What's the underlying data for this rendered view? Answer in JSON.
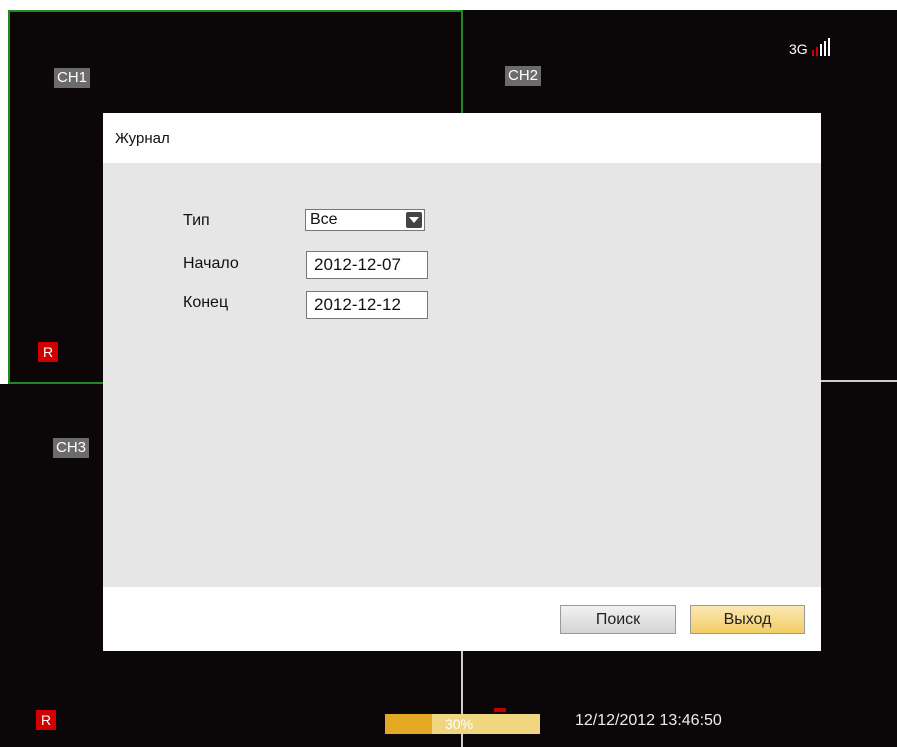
{
  "channels": {
    "ch1": "CH1",
    "ch2": "CH2",
    "ch3": "CH3"
  },
  "rec_badge": "R",
  "network": {
    "label": "3G",
    "signal_icon": "signal-bars-icon"
  },
  "dialog": {
    "title": "Журнал",
    "fields": {
      "type_label": "Тип",
      "type_value": "Все",
      "start_label": "Начало",
      "start_value": "2012-12-07",
      "end_label": "Конец",
      "end_value": "2012-12-12"
    },
    "buttons": {
      "search": "Поиск",
      "exit": "Выход"
    }
  },
  "status": {
    "progress_percent": 30,
    "progress_text": "30%",
    "datetime": "12/12/2012 13:46:50"
  },
  "colors": {
    "selected_border": "#1f8a1f",
    "record_badge": "#d10000",
    "exit_button": "#f3cd65",
    "progress_fill": "#e4a825"
  }
}
